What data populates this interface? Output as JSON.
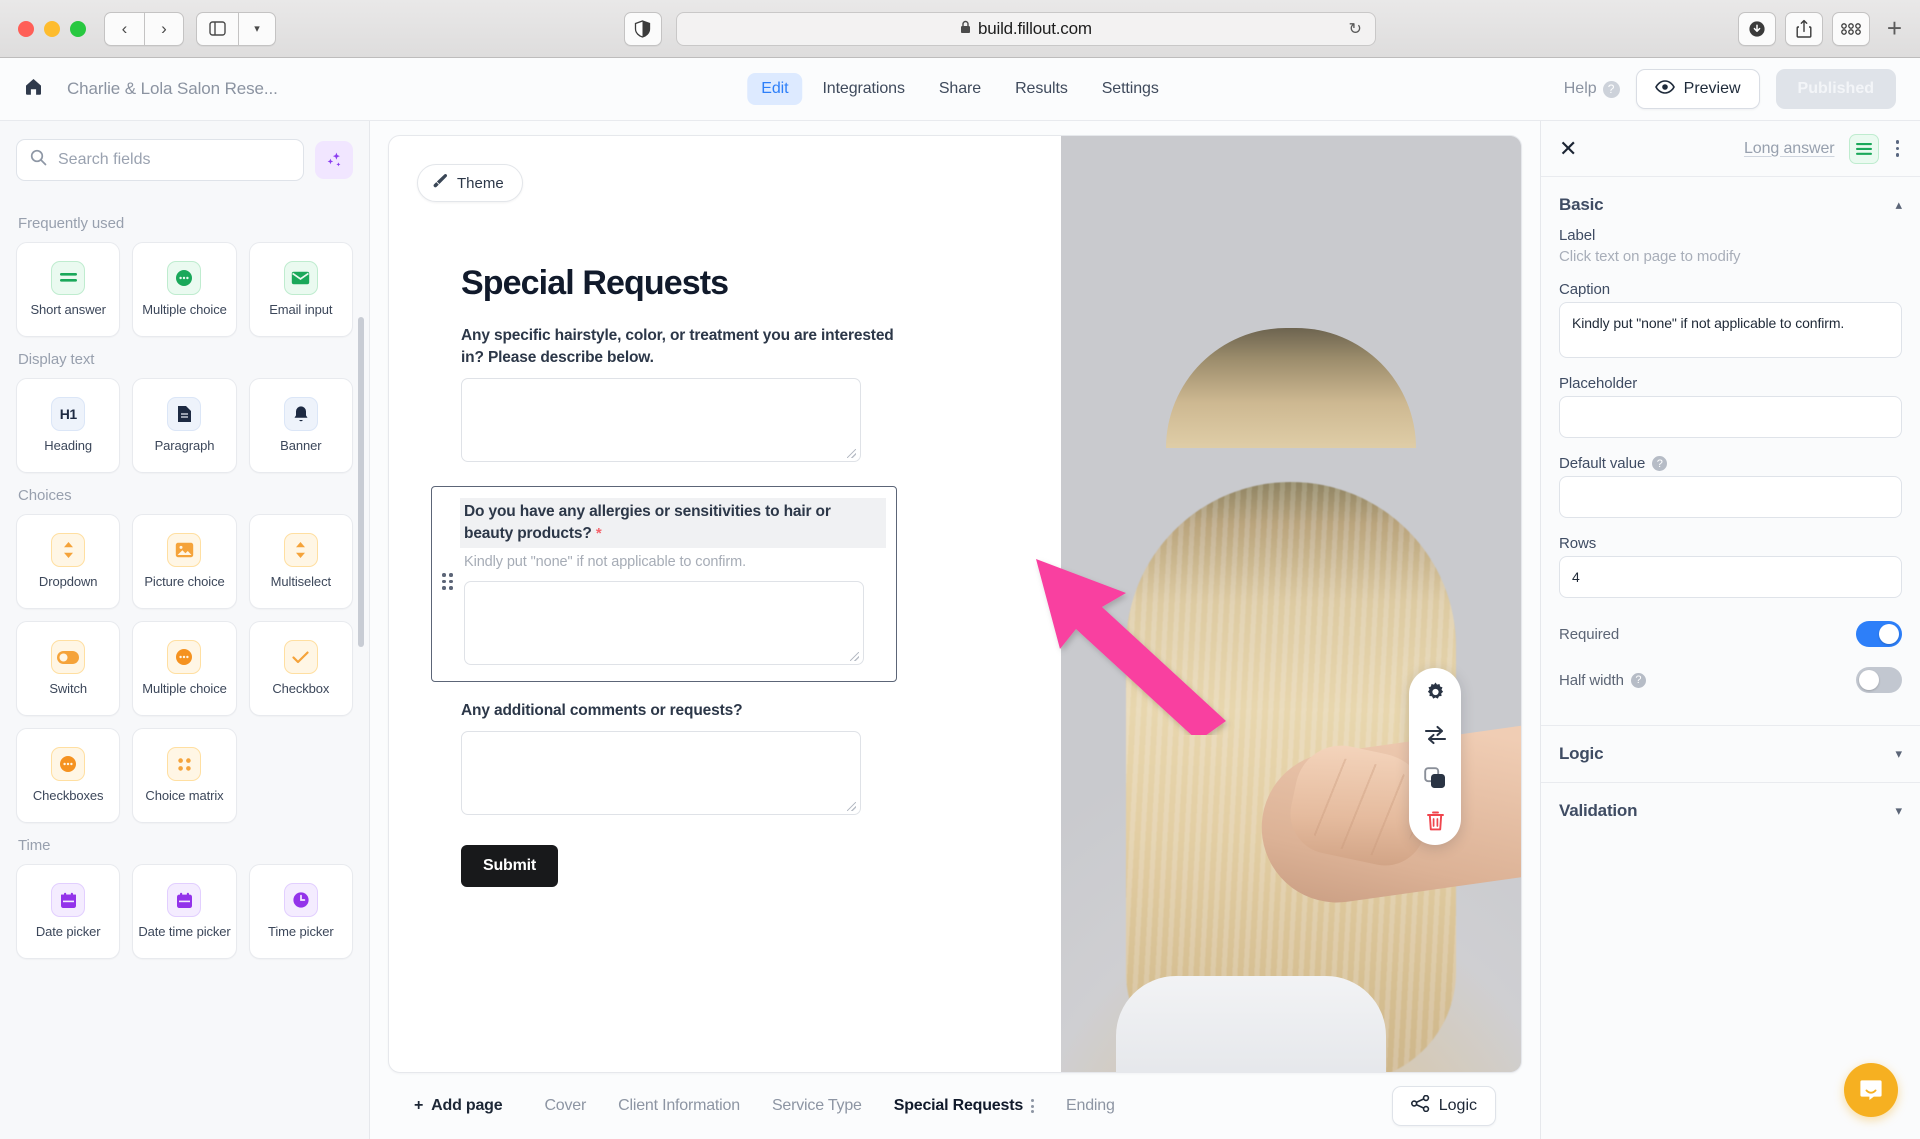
{
  "browser": {
    "url": "build.fillout.com",
    "lock_icon": "lock-icon",
    "back_icon": "chevron-left-icon",
    "forward_icon": "chevron-right-icon",
    "sidebar_icon": "sidebar-toggle-icon",
    "dropdown_icon": "chevron-down-icon",
    "shield_icon": "privacy-shield-icon",
    "reload_icon": "reload-icon",
    "download_icon": "download-icon",
    "share_icon": "share-icon",
    "tabs_overview_icon": "tab-overview-icon",
    "new_tab_icon": "plus-icon"
  },
  "header": {
    "home_icon": "home-icon",
    "form_title": "Charlie & Lola Salon Rese...",
    "tabs": [
      {
        "label": "Edit",
        "active": true
      },
      {
        "label": "Integrations",
        "active": false
      },
      {
        "label": "Share",
        "active": false
      },
      {
        "label": "Results",
        "active": false
      },
      {
        "label": "Settings",
        "active": false
      }
    ],
    "help_label": "Help",
    "help_icon": "question-circle-icon",
    "preview_label": "Preview",
    "preview_icon": "eye-icon",
    "published_label": "Published"
  },
  "sidebar": {
    "search_placeholder": "Search fields",
    "search_icon": "search-icon",
    "ai_icon": "sparkles-icon",
    "groups": [
      {
        "label": "Frequently used",
        "items": [
          {
            "label": "Short answer",
            "icon": "equals-lines-icon",
            "tone": "green"
          },
          {
            "label": "Multiple choice",
            "icon": "radio-filled-icon",
            "tone": "green"
          },
          {
            "label": "Email input",
            "icon": "envelope-icon",
            "tone": "green"
          }
        ]
      },
      {
        "label": "Display text",
        "items": [
          {
            "label": "Heading",
            "icon": "h1-icon",
            "tone": "blue"
          },
          {
            "label": "Paragraph",
            "icon": "document-icon",
            "tone": "blue"
          },
          {
            "label": "Banner",
            "icon": "bell-icon",
            "tone": "blue"
          }
        ]
      },
      {
        "label": "Choices",
        "items": [
          {
            "label": "Dropdown",
            "icon": "updown-chevrons-icon",
            "tone": "amber"
          },
          {
            "label": "Picture choice",
            "icon": "image-icon",
            "tone": "amber"
          },
          {
            "label": "Multiselect",
            "icon": "updown-chevrons-icon",
            "tone": "amber"
          },
          {
            "label": "Switch",
            "icon": "toggle-icon",
            "tone": "amber"
          },
          {
            "label": "Multiple choice",
            "icon": "radio-filled-icon",
            "tone": "amber"
          },
          {
            "label": "Checkbox",
            "icon": "checkmark-icon",
            "tone": "amber"
          },
          {
            "label": "Checkboxes",
            "icon": "radio-filled-icon",
            "tone": "amber"
          },
          {
            "label": "Choice matrix",
            "icon": "grid-dots-icon",
            "tone": "amber"
          }
        ]
      },
      {
        "label": "Time",
        "items": [
          {
            "label": "Date picker",
            "icon": "calendar-icon",
            "tone": "purple"
          },
          {
            "label": "Date time picker",
            "icon": "calendar-icon",
            "tone": "purple"
          },
          {
            "label": "Time picker",
            "icon": "clock-icon",
            "tone": "purple"
          }
        ]
      }
    ]
  },
  "canvas": {
    "theme_label": "Theme",
    "theme_icon": "paintbrush-icon",
    "page_heading": "Special Requests",
    "questions": [
      {
        "label": "Any specific hairstyle, color, or treatment you are interested in? Please describe below.",
        "caption": "",
        "required": false,
        "selected": false
      },
      {
        "label": "Do you have any allergies or sensitivities to hair or beauty products?",
        "required_mark": "*",
        "caption": "Kindly put \"none\" if not applicable to confirm.",
        "required": true,
        "selected": true,
        "drag_handle_icon": "drag-handle-icon"
      },
      {
        "label": "Any additional comments or requests?",
        "caption": "",
        "required": false,
        "selected": false
      }
    ],
    "submit_label": "Submit",
    "action_rail": [
      {
        "icon": "gear-icon",
        "name": "settings"
      },
      {
        "icon": "swap-arrows-icon",
        "name": "change-type"
      },
      {
        "icon": "duplicate-icon",
        "name": "duplicate"
      },
      {
        "icon": "trash-icon",
        "name": "delete"
      }
    ],
    "annotation_arrow": {
      "icon": "pink-arrow-icon",
      "color": "#f93fa0",
      "points_to": "gear-icon"
    }
  },
  "pagebar": {
    "add_page_label": "Add page",
    "add_page_icon": "plus-icon",
    "pages": [
      {
        "label": "Cover",
        "active": false
      },
      {
        "label": "Client Information",
        "active": false
      },
      {
        "label": "Service Type",
        "active": false
      },
      {
        "label": "Special Requests",
        "active": true,
        "kebab_icon": "kebab-menu-icon"
      },
      {
        "label": "Ending",
        "active": false
      }
    ],
    "logic_label": "Logic",
    "logic_icon": "share-nodes-icon"
  },
  "rightpanel": {
    "close_icon": "close-icon",
    "field_type": "Long answer",
    "type_icon": "long-answer-lines-icon",
    "more_icon": "kebab-menu-icon",
    "basic": {
      "title": "Basic",
      "collapse_icon": "chevron-up-icon",
      "label_title": "Label",
      "label_hint": "Click text on page to modify",
      "caption_title": "Caption",
      "caption_value": "Kindly put \"none\" if not applicable to confirm.",
      "placeholder_title": "Placeholder",
      "placeholder_value": "",
      "default_value_title": "Default value",
      "default_value_info_icon": "info-icon",
      "default_value": "",
      "rows_title": "Rows",
      "rows_value": "4",
      "required_title": "Required",
      "required_on": true,
      "half_width_title": "Half width",
      "half_width_info_icon": "info-icon",
      "half_width_on": false
    },
    "logic": {
      "title": "Logic",
      "expand_icon": "chevron-down-icon"
    },
    "validation": {
      "title": "Validation",
      "expand_icon": "chevron-down-icon"
    },
    "chat_icon": "intercom-chat-icon"
  },
  "colors": {
    "accent_blue": "#2d7ff9",
    "toggle_on": "#2d7ff9",
    "required_star": "#f4636b",
    "annotation_pink": "#f93fa0",
    "chat_yellow": "#f6b021",
    "submit_black": "#18191b"
  }
}
